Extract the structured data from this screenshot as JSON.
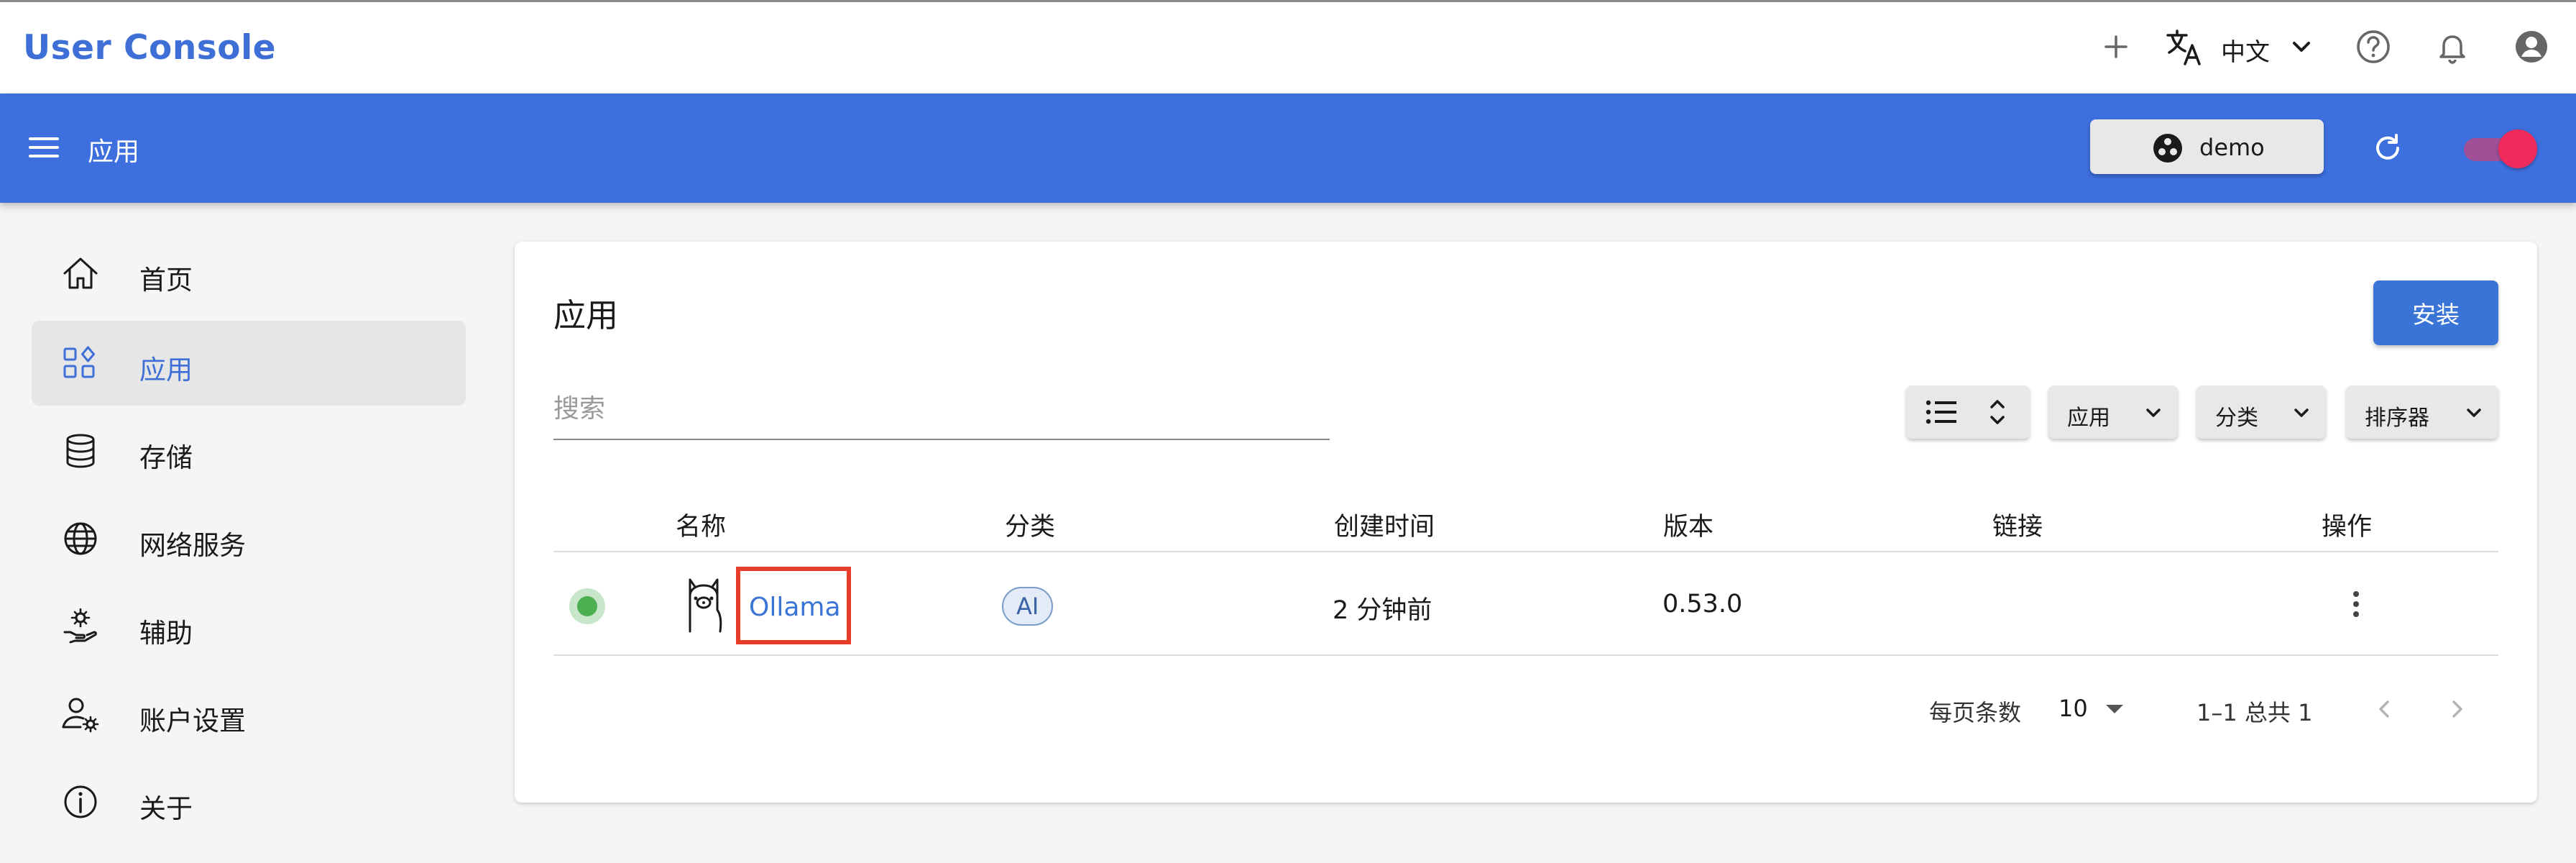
{
  "top": {
    "brand": "User Console",
    "language": "中文",
    "icons": [
      "plus-icon",
      "translate-icon",
      "chevron-down-icon",
      "help-icon",
      "bell-icon",
      "account-icon"
    ]
  },
  "appbar": {
    "title": "应用",
    "environment": "demo"
  },
  "sidebar": {
    "items": [
      {
        "label": "首页",
        "icon": "home-icon"
      },
      {
        "label": "应用",
        "icon": "apps-icon",
        "active": true
      },
      {
        "label": "存储",
        "icon": "database-icon"
      },
      {
        "label": "网络服务",
        "icon": "globe-icon"
      },
      {
        "label": "辅助",
        "icon": "hand-gear-icon"
      },
      {
        "label": "账户设置",
        "icon": "user-gear-icon"
      },
      {
        "label": "关于",
        "icon": "info-icon"
      }
    ]
  },
  "main": {
    "title": "应用",
    "install_label": "安装",
    "search_placeholder": "搜索",
    "filters": {
      "app": "应用",
      "category": "分类",
      "sorter": "排序器"
    },
    "columns": [
      "名称",
      "分类",
      "创建时间",
      "版本",
      "链接",
      "操作"
    ],
    "rows": [
      {
        "status": "running",
        "name": "Ollama",
        "category": "AI",
        "created": "2 分钟前",
        "version": "0.53.0",
        "link": ""
      }
    ],
    "pagination": {
      "rows_per_page_label": "每页条数",
      "rows_per_page": "10",
      "range": "1–1 总共 1"
    }
  },
  "colors": {
    "brand": "#3d6fd6",
    "appbar": "#3d6fde",
    "status_running": "#4caf50",
    "highlight_box": "#e53d2a",
    "toggle": "#f02a5a"
  }
}
